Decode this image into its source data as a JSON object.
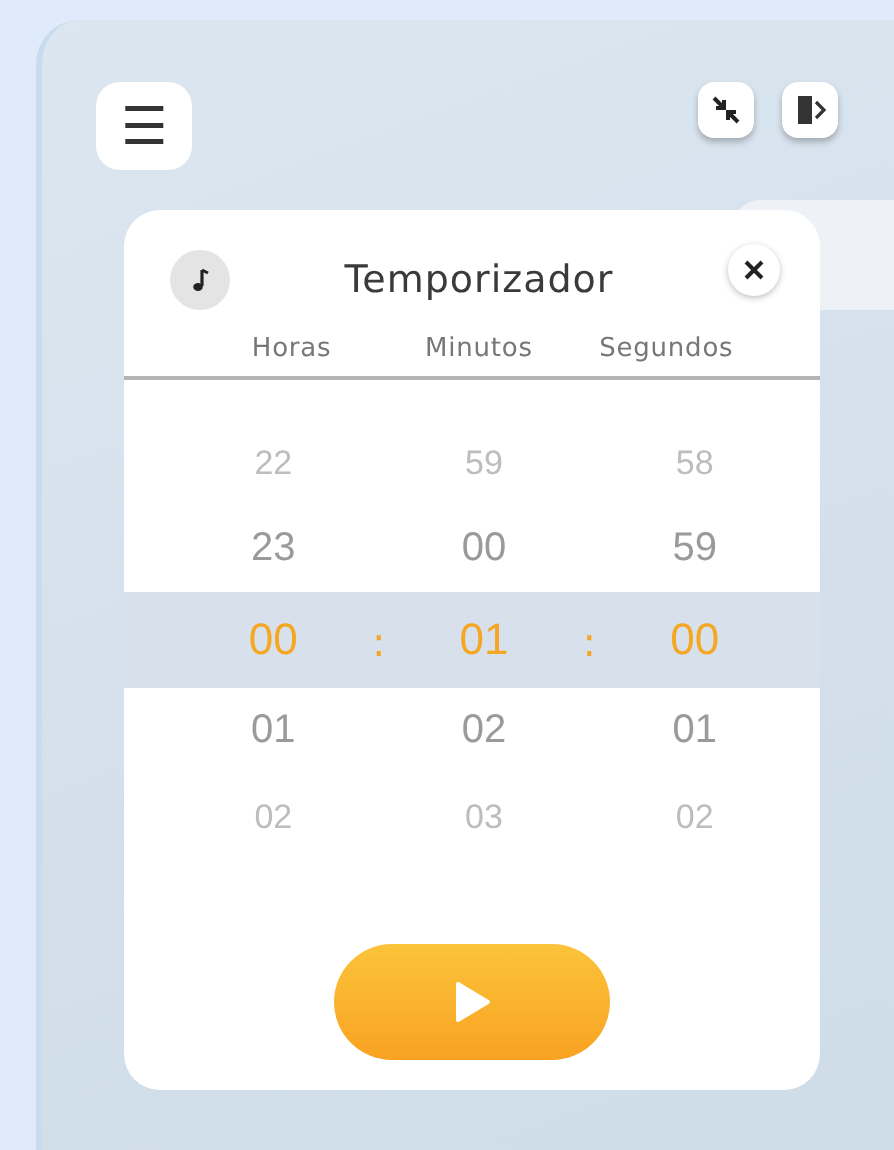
{
  "toolbar": {
    "menu_icon": "☰"
  },
  "timer": {
    "title": "Temporizador",
    "columns": [
      {
        "label": "Horas",
        "values": [
          {
            "text": "22",
            "selected": false
          },
          {
            "text": "23",
            "selected": false
          },
          {
            "text": "00",
            "selected": true
          },
          {
            "text": "01",
            "selected": false
          },
          {
            "text": "02",
            "selected": false
          }
        ]
      },
      {
        "label": "Minutos",
        "values": [
          {
            "text": "59",
            "selected": false
          },
          {
            "text": "00",
            "selected": false
          },
          {
            "text": "01",
            "selected": true
          },
          {
            "text": "02",
            "selected": false
          },
          {
            "text": "03",
            "selected": false
          }
        ]
      },
      {
        "label": "Segundos",
        "values": [
          {
            "text": "58",
            "selected": false
          },
          {
            "text": "59",
            "selected": false
          },
          {
            "text": "00",
            "selected": true
          },
          {
            "text": "01",
            "selected": false
          },
          {
            "text": "02",
            "selected": false
          }
        ]
      }
    ],
    "separator": ":"
  }
}
